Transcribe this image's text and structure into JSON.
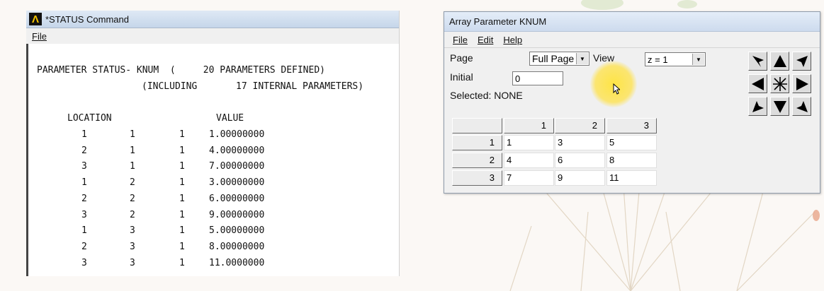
{
  "status_window": {
    "title": "*STATUS  Command",
    "menu": [
      "File"
    ],
    "header_line1": "PARAMETER STATUS- KNUM  (     20 PARAMETERS DEFINED)",
    "header_line2": "(INCLUDING       17 INTERNAL PARAMETERS)",
    "col_location": "LOCATION",
    "col_value": "VALUE",
    "rows": [
      {
        "i": "1",
        "j": "1",
        "k": "1",
        "value": "1.00000000"
      },
      {
        "i": "2",
        "j": "1",
        "k": "1",
        "value": "4.00000000"
      },
      {
        "i": "3",
        "j": "1",
        "k": "1",
        "value": "7.00000000"
      },
      {
        "i": "1",
        "j": "2",
        "k": "1",
        "value": "3.00000000"
      },
      {
        "i": "2",
        "j": "2",
        "k": "1",
        "value": "6.00000000"
      },
      {
        "i": "3",
        "j": "2",
        "k": "1",
        "value": "9.00000000"
      },
      {
        "i": "1",
        "j": "3",
        "k": "1",
        "value": "5.00000000"
      },
      {
        "i": "2",
        "j": "3",
        "k": "1",
        "value": "8.00000000"
      },
      {
        "i": "3",
        "j": "3",
        "k": "1",
        "value": "11.0000000"
      }
    ]
  },
  "array_window": {
    "title": "Array Parameter KNUM",
    "menu": [
      "File",
      "Edit",
      "Help"
    ],
    "page_label": "Page",
    "page_value": "Full Page",
    "view_label": "View",
    "view_value": "z = 1",
    "initial_label": "Initial",
    "initial_value": "0",
    "selected_text": "Selected: NONE",
    "col_headers": [
      "1",
      "2",
      "3"
    ],
    "row_headers": [
      "1",
      "2",
      "3"
    ],
    "cells": [
      [
        "1",
        "3",
        "5"
      ],
      [
        "4",
        "6",
        "8"
      ],
      [
        "7",
        "9",
        "11"
      ]
    ],
    "nav_icons": [
      "arrow-up-left-icon",
      "arrow-up-icon",
      "arrow-up-right-icon",
      "arrow-left-icon",
      "center-star-icon",
      "arrow-right-icon",
      "arrow-down-left-icon",
      "arrow-down-icon",
      "arrow-down-right-icon"
    ]
  },
  "colors": {
    "background": "#fbf8f5",
    "cursor_highlight": "#ffe23c"
  }
}
